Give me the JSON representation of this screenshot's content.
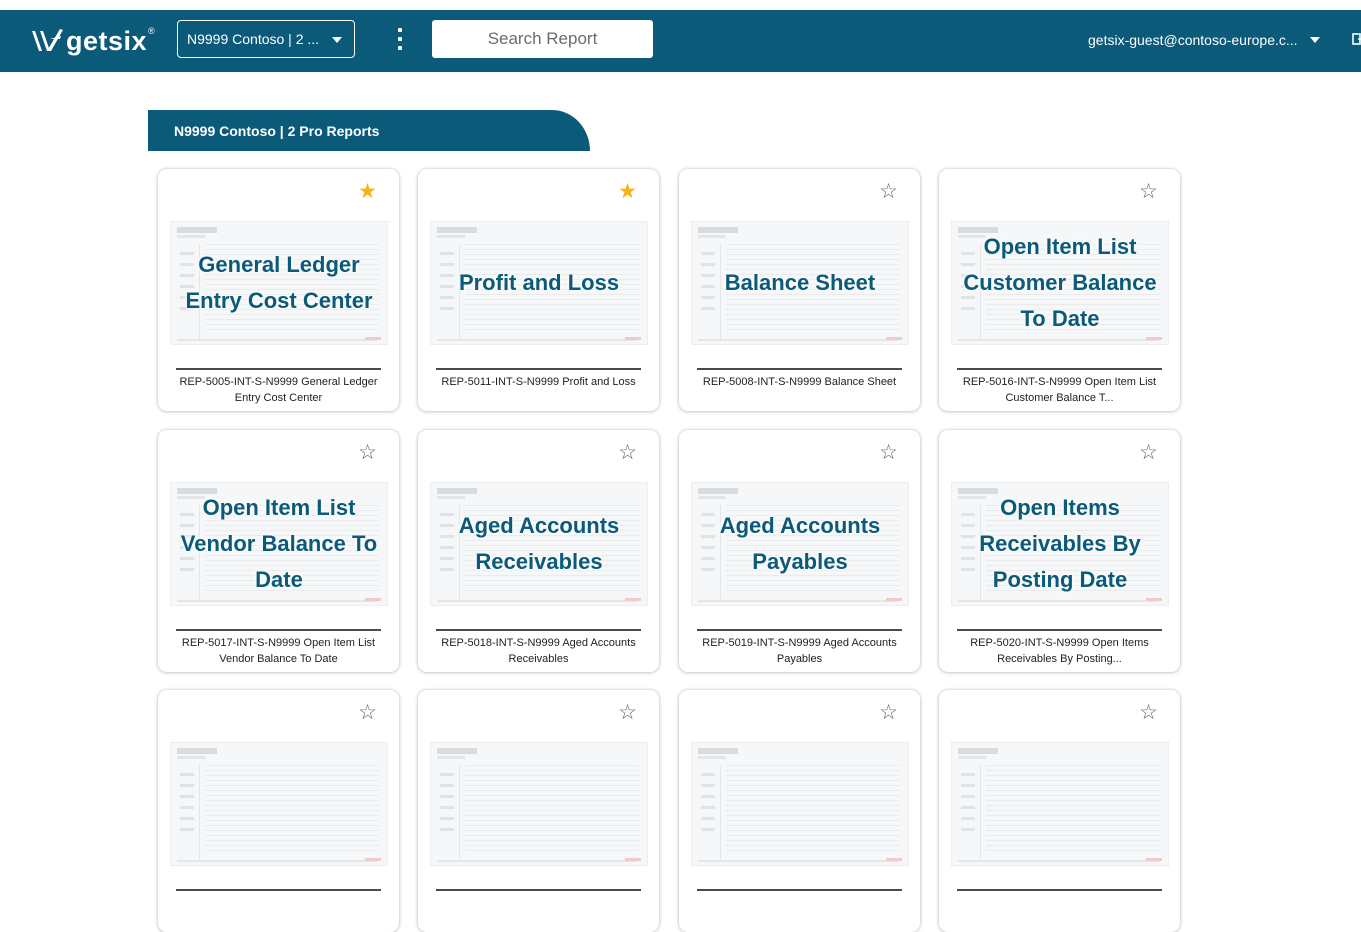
{
  "header": {
    "logo_text": "getsix",
    "logo_reg": "®",
    "client_selector": "N9999 Contoso | 2 ...",
    "search_placeholder": "Search Report",
    "user_menu": "getsix-guest@contoso-europe.c..."
  },
  "section": {
    "title": "N9999 Contoso | 2 Pro Reports"
  },
  "reports": [
    {
      "thumb_label": "General Ledger Entry Cost Center",
      "title": "REP-5005-INT-S-N9999 General Ledger Entry Cost Center",
      "favorite": true
    },
    {
      "thumb_label": "Profit and Loss",
      "title": "REP-5011-INT-S-N9999 Profit and Loss",
      "favorite": true
    },
    {
      "thumb_label": "Balance Sheet",
      "title": "REP-5008-INT-S-N9999 Balance Sheet",
      "favorite": false
    },
    {
      "thumb_label": "Open Item List Customer Balance To Date",
      "title": "REP-5016-INT-S-N9999 Open Item List Customer Balance T...",
      "favorite": false
    },
    {
      "thumb_label": "Open Item List Vendor Balance To Date",
      "title": "REP-5017-INT-S-N9999 Open Item List Vendor Balance To Date",
      "favorite": false
    },
    {
      "thumb_label": "Aged Accounts Receivables",
      "title": "REP-5018-INT-S-N9999 Aged Accounts Receivables",
      "favorite": false
    },
    {
      "thumb_label": "Aged Accounts Payables",
      "title": "REP-5019-INT-S-N9999 Aged Accounts Payables",
      "favorite": false
    },
    {
      "thumb_label": "Open Items Receivables By Posting Date",
      "title": "REP-5020-INT-S-N9999 Open Items Receivables By Posting...",
      "favorite": false
    },
    {
      "thumb_label": "",
      "title": "",
      "favorite": false
    },
    {
      "thumb_label": "",
      "title": "",
      "favorite": false
    },
    {
      "thumb_label": "",
      "title": "",
      "favorite": false
    },
    {
      "thumb_label": "",
      "title": "",
      "favorite": false
    }
  ],
  "icons": {
    "star_filled": "★",
    "star_empty": "☆",
    "favorite_color": "#f7b319",
    "brand_color": "#0b5a7a"
  }
}
